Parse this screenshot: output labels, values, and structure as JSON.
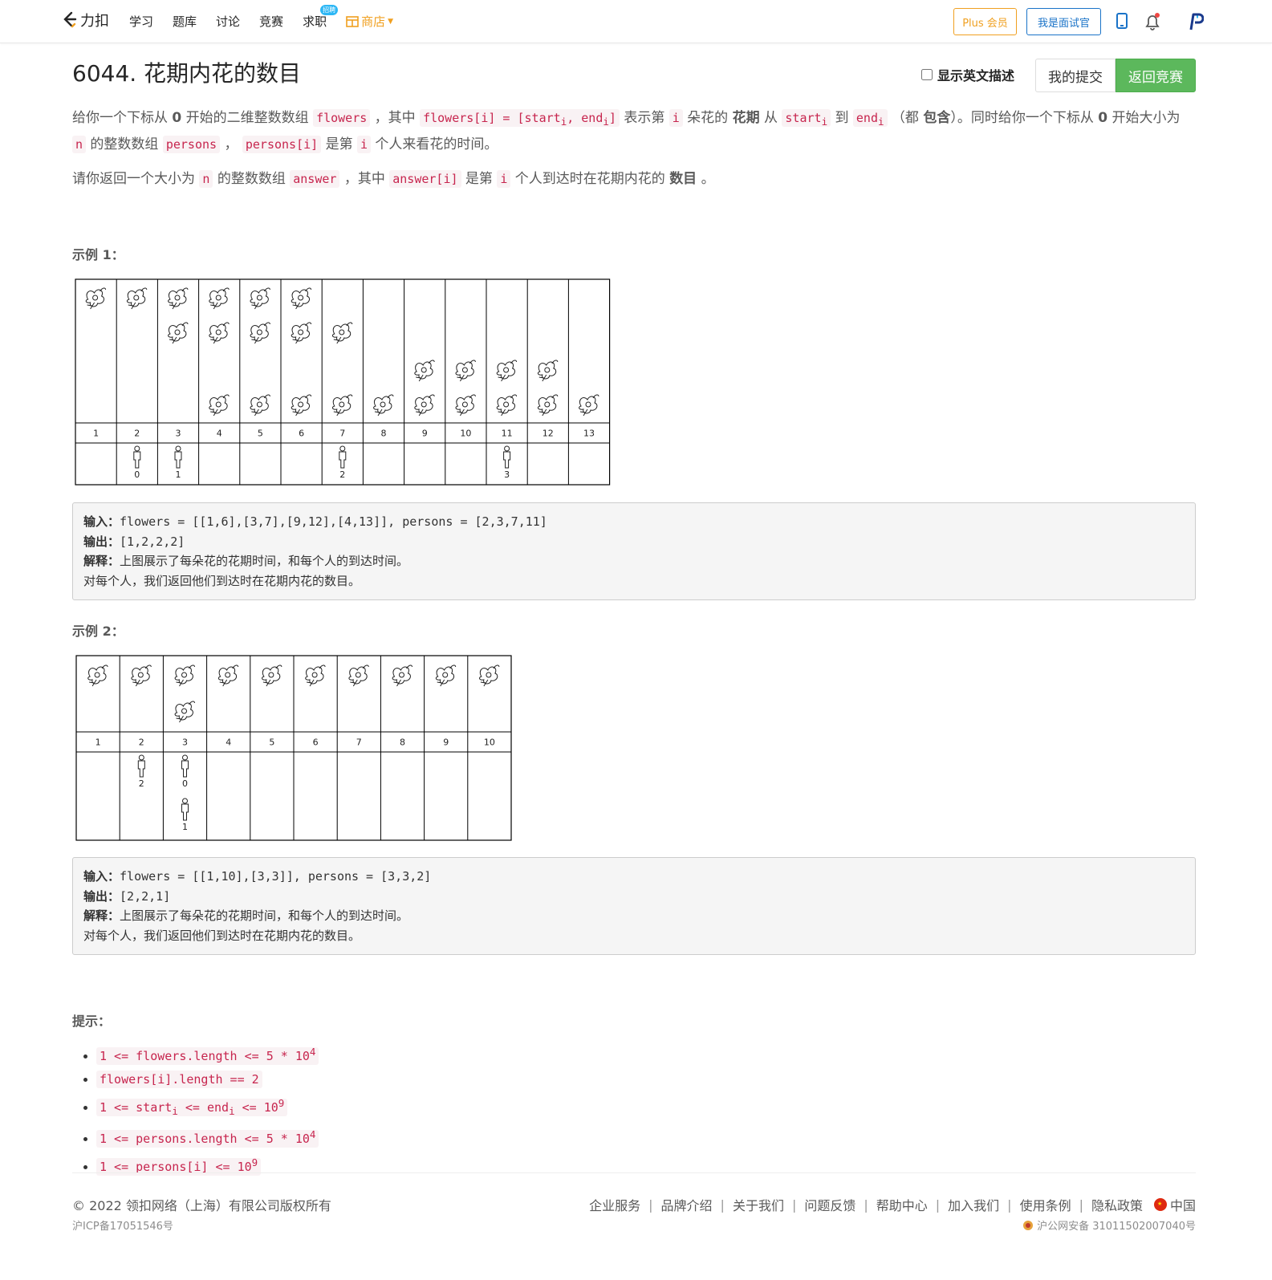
{
  "nav": {
    "logo_text": "力扣",
    "items": [
      "学习",
      "题库",
      "讨论",
      "竞赛",
      "求职"
    ],
    "hire_badge": "招聘",
    "shop": "商店",
    "plus": "Plus 会员",
    "interviewer": "我是面试官",
    "colors": {
      "shop": "#f0a020",
      "blue": "#1a73c8"
    }
  },
  "problem": {
    "title": "6044. 花期内花的数目",
    "show_english": "显示英文描述",
    "my_submissions": "我的提交",
    "back_contest": "返回竞赛"
  },
  "desc": {
    "p1": {
      "t1": "给你一个下标从 ",
      "zero": "0",
      "t2": " 开始的二维整数数组 ",
      "c_flowers": "flowers",
      "t3": " ，其中 ",
      "c_flowers_i": "flowers[i] = [start",
      "sub_i": "i",
      "c_comma_end": ", end",
      "c_close": "]",
      "t4": " 表示第 ",
      "c_i": "i",
      "t5": " 朵花的 ",
      "b_bloom": "花期",
      "t6": " 从 ",
      "c_start": "start",
      "t7": " 到 ",
      "c_end": "end",
      "t8": " （都 ",
      "b_incl": "包含",
      "t9": "）。同时给你一个下标从 ",
      "t10": " 开始大小为 ",
      "c_n": "n",
      "t11": " 的整数数组 ",
      "c_persons": "persons",
      "t12": " ， ",
      "c_persons_i": "persons[i]",
      "t13": " 是第 ",
      "t14": " 个人来看花的时间。"
    },
    "p2": {
      "t1": "请你返回一个大小为 ",
      "t2": " 的整数数组 ",
      "c_answer": "answer",
      "t3": " ，其中 ",
      "c_answer_i": "answer[i]",
      "t4": " 是第 ",
      "t5": " 个人到达时在花期内花的 ",
      "b_count": "数目",
      "t6": " 。"
    }
  },
  "examples": [
    {
      "heading": "示例 1：",
      "input_label": "输入：",
      "input": "flowers = [[1,6],[3,7],[9,12],[4,13]], persons = [2,3,7,11]",
      "output_label": "输出：",
      "output": "[1,2,2,2]",
      "expl_label": "解释：",
      "expl": "上图展示了每朵花的花期时间，和每个人的到达时间。",
      "expl2": "对每个人，我们返回他们到达时在花期内花的数目。",
      "figure": {
        "cols": [
          "1",
          "2",
          "3",
          "4",
          "5",
          "6",
          "7",
          "8",
          "9",
          "10",
          "11",
          "12",
          "13"
        ],
        "flowers": [
          [
            1,
            6
          ],
          [
            3,
            7
          ],
          [
            9,
            12
          ],
          [
            4,
            13
          ]
        ],
        "persons": [
          {
            "time": 2,
            "label": "0"
          },
          {
            "time": 3,
            "label": "1"
          },
          {
            "time": 7,
            "label": "2"
          },
          {
            "time": 11,
            "label": "3"
          }
        ]
      }
    },
    {
      "heading": "示例 2：",
      "input_label": "输入：",
      "input": "flowers = [[1,10],[3,3]], persons = [3,3,2]",
      "output_label": "输出：",
      "output": "[2,2,1]",
      "expl_label": "解释：",
      "expl": "上图展示了每朵花的花期时间，和每个人的到达时间。",
      "expl2": "对每个人，我们返回他们到达时在花期内花的数目。",
      "figure": {
        "cols": [
          "1",
          "2",
          "3",
          "4",
          "5",
          "6",
          "7",
          "8",
          "9",
          "10"
        ],
        "flowers": [
          [
            1,
            10
          ],
          [
            3,
            3
          ]
        ],
        "persons": [
          {
            "time": 2,
            "label": "2"
          },
          {
            "time": 3,
            "label": "0"
          },
          {
            "time": 3,
            "label": "1"
          }
        ]
      }
    }
  ],
  "hints": {
    "heading": "提示：",
    "h1": {
      "a": "1 <= flowers.length <= 5 * 10",
      "sup": "4"
    },
    "h2": {
      "a": "flowers[i].length == 2"
    },
    "h3": {
      "a": "1 <= start",
      "sub1": "i",
      "b": " <= end",
      "sub2": "i",
      "c": " <= 10",
      "sup": "9"
    },
    "h4": {
      "a": "1 <= persons.length <= 5 * 10",
      "sup": "4"
    },
    "h5": {
      "a": "1 <= persons[i] <= 10",
      "sup": "9"
    }
  },
  "footer": {
    "copyright": "© 2022 领扣网络（上海）有限公司版权所有",
    "icp": "沪ICP备17051546号",
    "links": [
      "企业服务",
      "品牌介绍",
      "关于我们",
      "问题反馈",
      "帮助中心",
      "加入我们",
      "使用条例",
      "隐私政策"
    ],
    "region": "中国",
    "police": "沪公网安备 31011502007040号"
  }
}
